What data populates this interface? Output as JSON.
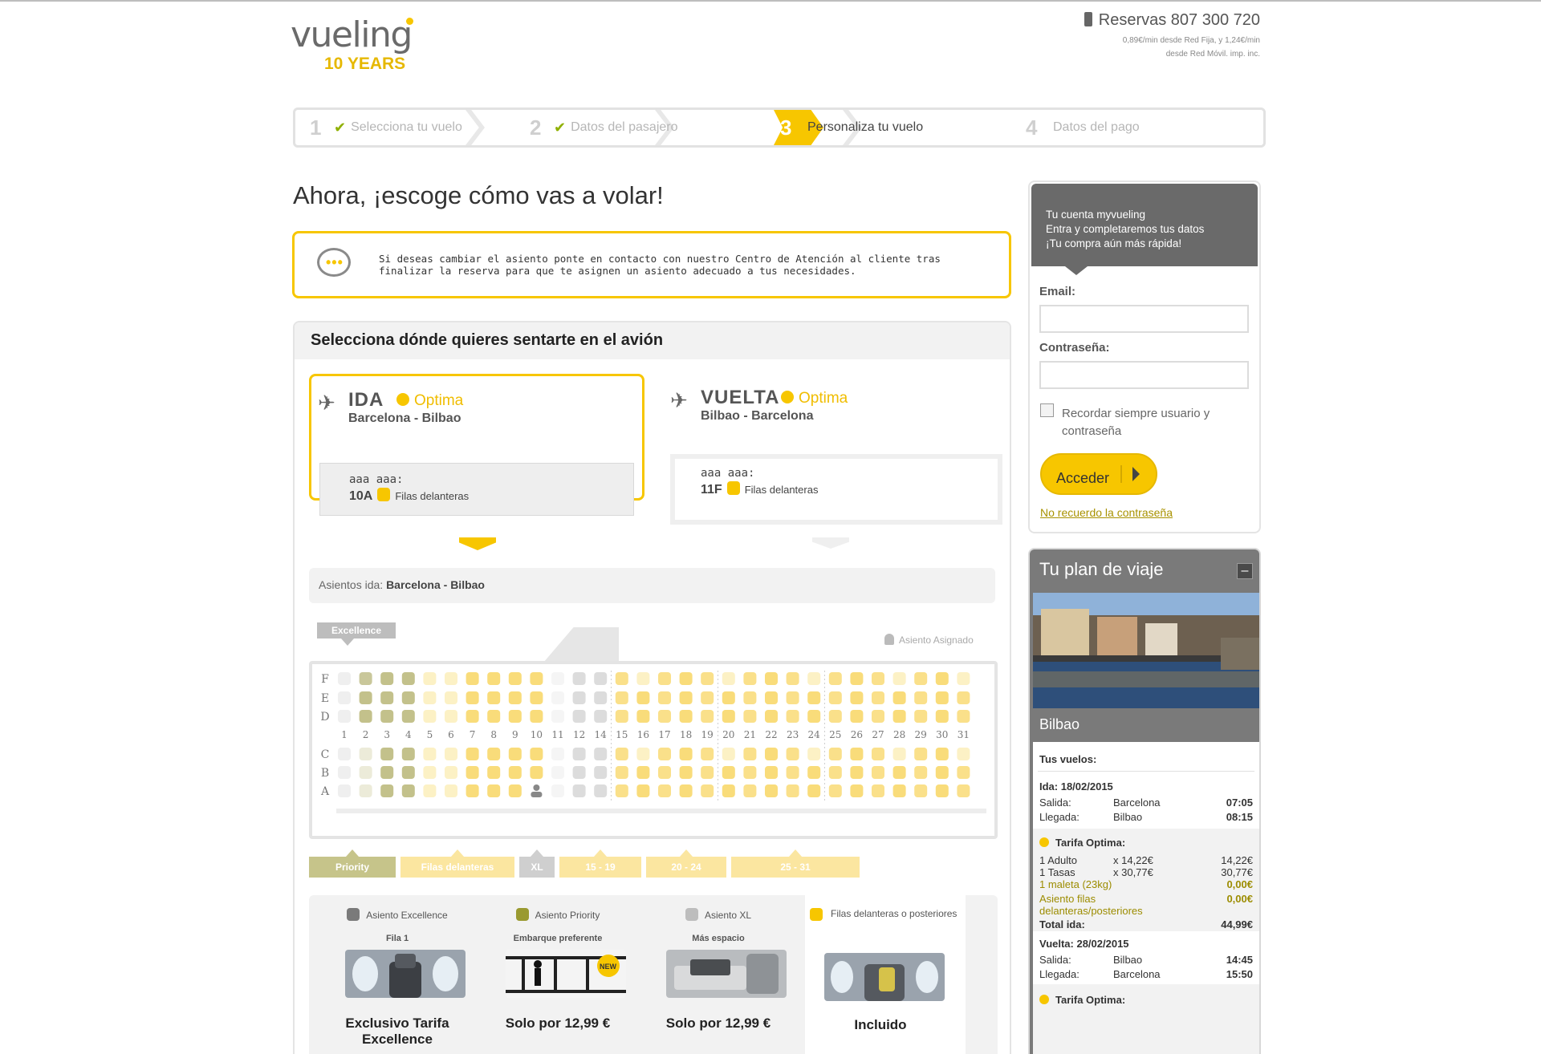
{
  "header": {
    "logo_word": "vueling",
    "logo_sub": "10 YEARS",
    "phone": "Reservas 807 300 720",
    "phone_fine_1": "0,89€/min desde Red Fija, y 1,24€/min",
    "phone_fine_2": "desde Red Móvil. imp. inc."
  },
  "steps": [
    {
      "num": "1",
      "label": "Selecciona tu vuelo",
      "done": true
    },
    {
      "num": "2",
      "label": "Datos del pasajero",
      "done": true
    },
    {
      "num": "3",
      "label": "Personaliza tu vuelo",
      "active": true
    },
    {
      "num": "4",
      "label": "Datos del pago"
    }
  ],
  "page_title": "Ahora, ¡escoge cómo vas a volar!",
  "notice": {
    "line1": "Si deseas cambiar el asiento ponte en contacto con nuestro Centro de Atención al cliente tras",
    "line2": "finalizar la reserva para que te asignen un asiento adecuado a tus necesidades."
  },
  "seat_panel": {
    "title": "Selecciona dónde quieres sentarte en el avión",
    "ida": {
      "dir": "IDA",
      "tarifa": "Optima",
      "route": "Barcelona - Bilbao",
      "seat_label": "aaa aaa:",
      "seat": "10A",
      "zone": "Filas delanteras"
    },
    "vuelta": {
      "dir": "VUELTA",
      "tarifa": "Optima",
      "route": "Bilbao - Barcelona",
      "seat_label": "aaa aaa:",
      "seat": "11F",
      "zone": "Filas delanteras"
    },
    "asientos_prefix": "Asientos ida:",
    "asientos_route": "Barcelona - Bilbao",
    "excellence_tag": "Excellence",
    "asignado": "Asiento Asignado",
    "left_rows": [
      "F",
      "E",
      "D"
    ],
    "right_rows": [
      "C",
      "B",
      "A"
    ],
    "row_numbers": [
      "1",
      "2",
      "3",
      "4",
      "5",
      "6",
      "7",
      "8",
      "9",
      "10",
      "11",
      "12",
      "14",
      "15",
      "16",
      "17",
      "18",
      "19",
      "20",
      "21",
      "22",
      "23",
      "24",
      "25",
      "26",
      "27",
      "28",
      "29",
      "30",
      "31"
    ],
    "zones": [
      "Priority",
      "Filas delanteras",
      "XL",
      "15 - 19",
      "20 - 24",
      "25 - 31"
    ]
  },
  "legend": [
    {
      "name": "Asiento Excellence",
      "sub": "Fila 1",
      "price": "Exclusivo Tarifa Excellence",
      "color": "#7a7a7a"
    },
    {
      "name": "Asiento Priority",
      "sub": "Embarque preferente",
      "price": "Solo por 12,99 €",
      "color": "#9a9a30",
      "badge": "NEW"
    },
    {
      "name": "Asiento XL",
      "sub": "Más espacio",
      "price": "Solo por 12,99 €",
      "color": "#bdbdbd"
    },
    {
      "name": "Filas delanteras o posteriores",
      "sub": "",
      "price": "Incluido",
      "color": "#f7c600"
    }
  ],
  "login": {
    "intro1": "Tu cuenta myvueling",
    "intro2": "Entra y completaremos tus datos",
    "intro3": "¡Tu compra aún más rápida!",
    "email_label": "Email:",
    "pass_label": "Contraseña:",
    "remember": "Recordar siempre usuario y contraseña",
    "button": "Acceder",
    "forgot": "No recuerdo la contraseña"
  },
  "plan": {
    "title": "Tu plan de viaje",
    "minimize": "–",
    "city": "Bilbao",
    "vuelos_label": "Tus vuelos:",
    "ida_date": "Ida: 18/02/2015",
    "salida": "Salida:",
    "llegada": "Llegada:",
    "ida_from": "Barcelona",
    "ida_dep": "07:05",
    "ida_to": "Bilbao",
    "ida_arr": "08:15",
    "tarifa": "Tarifa Optima:",
    "adulto": "1 Adulto",
    "adulto_x": "x 14,22€",
    "adulto_t": "14,22€",
    "tasas": "1 Tasas",
    "tasas_x": "x 30,77€",
    "tasas_t": "30,77€",
    "maleta": "1 maleta (23kg)",
    "maleta_t": "0,00€",
    "asiento1": "Asiento filas",
    "asiento2": "delanteras/posteriores",
    "asiento_t": "0,00€",
    "total_ida": "Total ida:",
    "total_ida_v": "44,99€",
    "vuelta_date": "Vuelta: 28/02/2015",
    "vuelta_from": "Bilbao",
    "vuelta_dep": "14:45",
    "vuelta_to": "Barcelona",
    "vuelta_arr": "15:50",
    "tarifa2": "Tarifa Optima:"
  },
  "colors": {
    "accent": "#f7c600",
    "priority": "#b8b880",
    "dark": "#6a6a6a"
  }
}
